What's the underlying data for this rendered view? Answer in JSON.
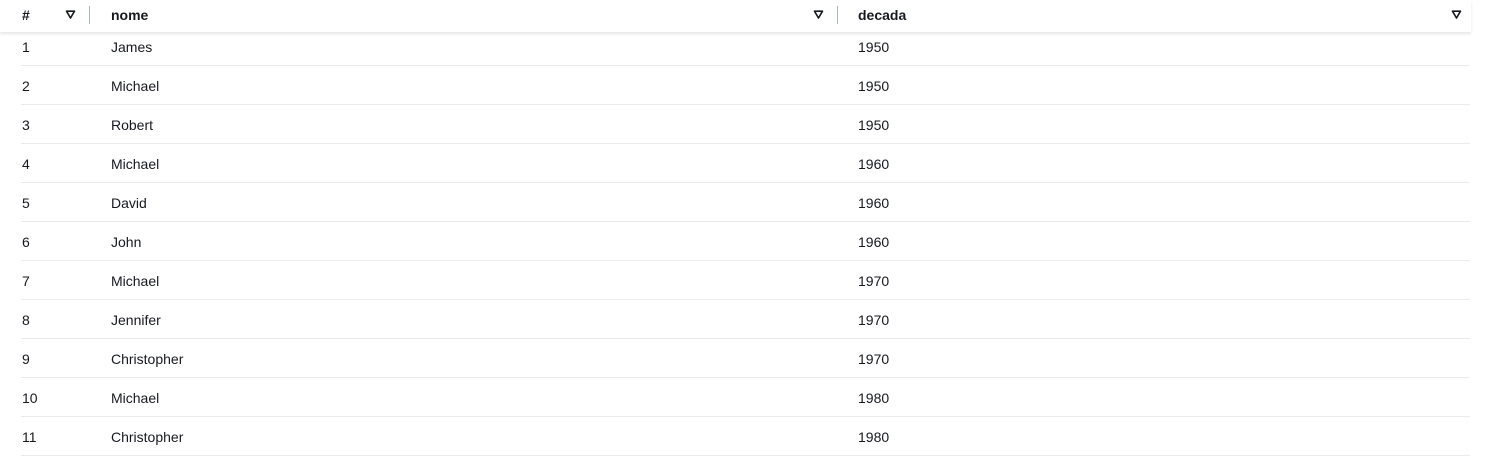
{
  "table": {
    "columns": [
      {
        "label": "#"
      },
      {
        "label": "nome"
      },
      {
        "label": "decada"
      }
    ],
    "rows": [
      {
        "num": "1",
        "nome": "James",
        "decada": "1950"
      },
      {
        "num": "2",
        "nome": "Michael",
        "decada": "1950"
      },
      {
        "num": "3",
        "nome": "Robert",
        "decada": "1950"
      },
      {
        "num": "4",
        "nome": "Michael",
        "decada": "1960"
      },
      {
        "num": "5",
        "nome": "David",
        "decada": "1960"
      },
      {
        "num": "6",
        "nome": "John",
        "decada": "1960"
      },
      {
        "num": "7",
        "nome": "Michael",
        "decada": "1970"
      },
      {
        "num": "8",
        "nome": "Jennifer",
        "decada": "1970"
      },
      {
        "num": "9",
        "nome": "Christopher",
        "decada": "1970"
      },
      {
        "num": "10",
        "nome": "Michael",
        "decada": "1980"
      },
      {
        "num": "11",
        "nome": "Christopher",
        "decada": "1980"
      }
    ]
  },
  "icons": {
    "sort": "sort-triangle-down-icon"
  },
  "colors": {
    "text": "#16191f",
    "row_border": "#e9ebed",
    "column_divider": "#aab7b8"
  }
}
